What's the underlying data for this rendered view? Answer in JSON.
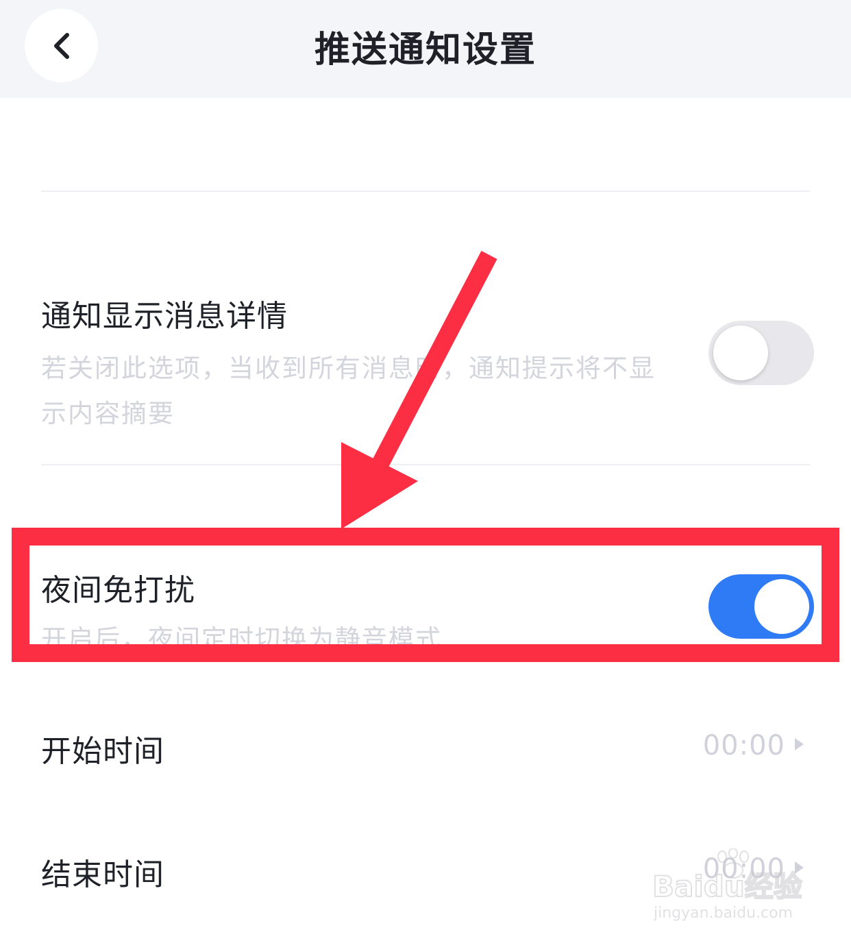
{
  "header": {
    "title": "推送通知设置",
    "back_icon": "chevron-left-icon"
  },
  "show_details": {
    "title": "通知显示消息详情",
    "desc": "若关闭此选项，当收到所有消息时，通知提示将不显示内容摘要",
    "toggle_on": false
  },
  "dnd": {
    "title": "夜间免打扰",
    "desc": "开启后，夜间定时切换为静音模式",
    "toggle_on": true
  },
  "start_time": {
    "label": "开始时间",
    "value": "00:00"
  },
  "end_time": {
    "label": "结束时间",
    "value": "00:00"
  },
  "watermark": {
    "main": "Baidu经验",
    "sub": "jingyan.baidu.com"
  },
  "colors": {
    "accent_blue": "#2f7bf6",
    "annotation_red": "#fb2e44",
    "header_bg": "#f4f5f8",
    "muted_text": "#d3d4dc"
  }
}
